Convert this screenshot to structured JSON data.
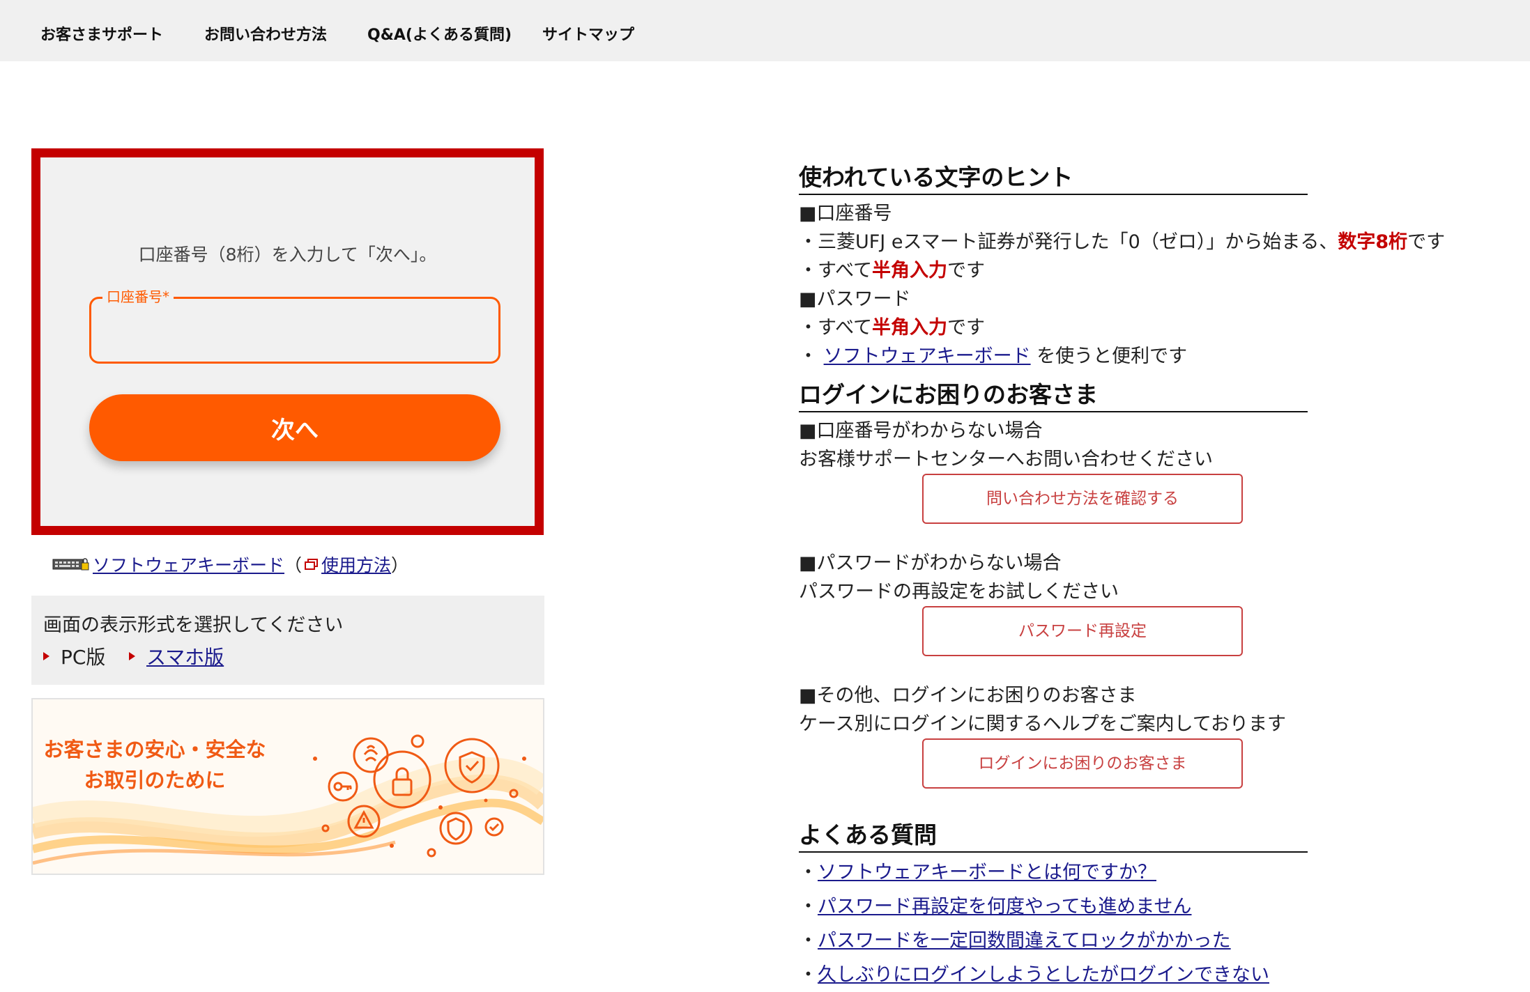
{
  "nav": {
    "items": [
      "お客さまサポート",
      "お問い合わせ方法",
      "Q&A(よくある質問)",
      "サイトマップ"
    ]
  },
  "login": {
    "instruction": "口座番号（8桁）を入力して「次へ」。",
    "account_label": "口座番号*",
    "next_label": "次へ"
  },
  "software_keyboard": {
    "link": "ソフトウェアキーボード",
    "open_paren": "（",
    "usage_link": "使用方法",
    "close_paren": "）"
  },
  "display_mode": {
    "title": "画面の表示形式を選択してください",
    "pc": "PC版",
    "smartphone": "スマホ版"
  },
  "banner": {
    "line1": "お客さまの安心・安全な",
    "line2": "お取引のために"
  },
  "hints": {
    "heading": "使われている文字のヒント",
    "account_heading": "■口座番号",
    "account_line_pre": "・三菱UFJ eスマート証券が発行した「0（ゼロ）」から始まる、",
    "account_line_em": "数字8桁",
    "account_line_post": "です",
    "halfwidth_pre": "・すべて",
    "halfwidth_em": "半角入力",
    "halfwidth_post": "です",
    "password_heading": "■パスワード",
    "kb_pre": "・",
    "kb_link": "ソフトウェアキーボード",
    "kb_post": "を使うと便利です"
  },
  "trouble": {
    "heading": "ログインにお困りのお客さま",
    "account_unknown": "■口座番号がわからない場合",
    "account_unknown_desc": "お客様サポートセンターへお問い合わせください",
    "contact_button": "問い合わせ方法を確認する",
    "password_unknown": "■パスワードがわからない場合",
    "password_unknown_desc": "パスワードの再設定をお試しください",
    "reset_button": "パスワード再設定",
    "other": "■その他、ログインにお困りのお客さま",
    "other_desc": "ケース別にログインに関するヘルプをご案内しております",
    "help_button": "ログインにお困りのお客さま"
  },
  "faq": {
    "heading": "よくある質問",
    "bullet": "・",
    "items": [
      "ソフトウェアキーボードとは何ですか？",
      "パスワード再設定を何度やっても進めません",
      "パスワードを一定回数間違えてロックがかかった",
      "久しぶりにログインしようとしたがログインできない"
    ]
  },
  "colors": {
    "accent": "#ff5a00",
    "frame_red": "#c40000",
    "link": "#1a1a8c"
  }
}
